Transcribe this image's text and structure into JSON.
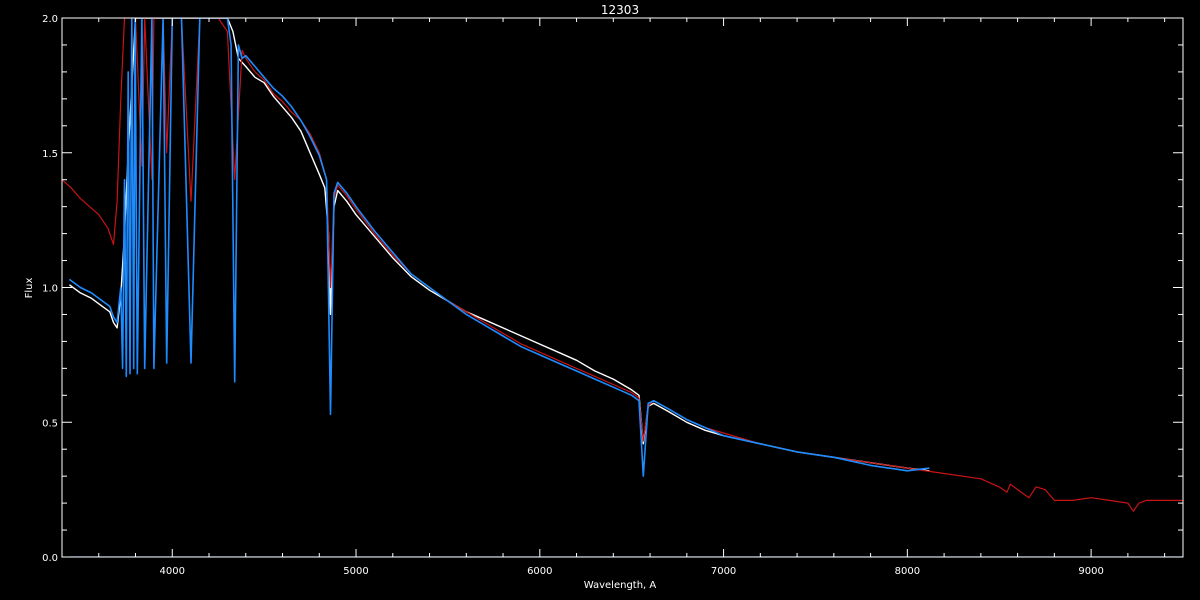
{
  "chart_data": {
    "type": "line",
    "title": "12303",
    "xlabel": "Wavelength, A",
    "ylabel": "Flux",
    "xlim": [
      3400,
      9500
    ],
    "ylim": [
      0.0,
      2.0
    ],
    "x_ticks": [
      4000,
      5000,
      6000,
      7000,
      8000,
      9000
    ],
    "y_ticks": [
      0.0,
      0.5,
      1.0,
      1.5,
      2.0
    ],
    "y_tick_labels": [
      "0.0",
      "0.5",
      "1.0",
      "1.5",
      "2.0"
    ],
    "grid": false,
    "background": "#000000",
    "series": [
      {
        "color": "#ffffff",
        "x": [
          3440,
          3500,
          3560,
          3620,
          3660,
          3680,
          3700,
          3720,
          3740,
          3760,
          3800,
          3850,
          3900,
          3950,
          4000,
          4050,
          4100,
          4150,
          4200,
          4250,
          4300,
          4330,
          4360,
          4400,
          4450,
          4500,
          4550,
          4600,
          4650,
          4700,
          4750,
          4800,
          4830,
          4850,
          4861,
          4880,
          4900,
          4950,
          5000,
          5100,
          5200,
          5300,
          5400,
          5500,
          5600,
          5700,
          5800,
          5900,
          6000,
          6100,
          6200,
          6300,
          6400,
          6500,
          6540,
          6563,
          6590,
          6620,
          6700,
          6800,
          6900,
          7000,
          7200,
          7400,
          7600,
          7800,
          8000,
          8120
        ],
        "y": [
          1.01,
          0.98,
          0.96,
          0.93,
          0.91,
          0.87,
          0.85,
          0.97,
          1.2,
          1.5,
          2.0,
          2.0,
          2.0,
          2.0,
          2.0,
          2.0,
          2.0,
          2.0,
          2.0,
          2.0,
          2.0,
          1.95,
          1.85,
          1.82,
          1.78,
          1.76,
          1.71,
          1.67,
          1.63,
          1.58,
          1.5,
          1.42,
          1.37,
          1.2,
          0.9,
          1.3,
          1.36,
          1.32,
          1.27,
          1.19,
          1.11,
          1.04,
          0.99,
          0.95,
          0.91,
          0.88,
          0.85,
          0.82,
          0.79,
          0.76,
          0.73,
          0.69,
          0.66,
          0.62,
          0.6,
          0.42,
          0.56,
          0.57,
          0.54,
          0.5,
          0.47,
          0.45,
          0.42,
          0.39,
          0.37,
          0.35,
          0.33,
          0.32
        ]
      },
      {
        "color": "#c81414",
        "x": [
          3400,
          3450,
          3500,
          3550,
          3600,
          3650,
          3680,
          3700,
          3720,
          3740,
          3760,
          3780,
          3800,
          3835,
          3850,
          3889,
          3900,
          3950,
          3970,
          4000,
          4050,
          4102,
          4150,
          4200,
          4250,
          4300,
          4340,
          4380,
          4400,
          4450,
          4500,
          4550,
          4600,
          4650,
          4700,
          4750,
          4800,
          4840,
          4861,
          4880,
          4900,
          4950,
          5000,
          5100,
          5200,
          5300,
          5400,
          5500,
          5600,
          5700,
          5800,
          5900,
          6000,
          6100,
          6200,
          6300,
          6400,
          6500,
          6540,
          6563,
          6590,
          6620,
          6700,
          6800,
          6900,
          7000,
          7200,
          7400,
          7600,
          7800,
          8000,
          8200,
          8400,
          8500,
          8542,
          8560,
          8600,
          8662,
          8700,
          8750,
          8800,
          8900,
          9000,
          9100,
          9200,
          9230,
          9260,
          9300,
          9400,
          9500
        ],
        "y": [
          1.4,
          1.37,
          1.33,
          1.3,
          1.27,
          1.22,
          1.16,
          1.32,
          1.7,
          2.0,
          2.0,
          2.0,
          2.0,
          1.45,
          2.0,
          1.4,
          2.0,
          2.0,
          1.5,
          2.0,
          2.0,
          1.32,
          2.0,
          2.0,
          2.0,
          1.95,
          1.4,
          1.88,
          1.85,
          1.8,
          1.77,
          1.72,
          1.69,
          1.65,
          1.62,
          1.57,
          1.5,
          1.4,
          1.0,
          1.33,
          1.38,
          1.34,
          1.29,
          1.2,
          1.12,
          1.05,
          1.0,
          0.95,
          0.91,
          0.87,
          0.83,
          0.79,
          0.76,
          0.73,
          0.7,
          0.67,
          0.64,
          0.61,
          0.59,
          0.43,
          0.56,
          0.58,
          0.55,
          0.51,
          0.48,
          0.46,
          0.42,
          0.39,
          0.37,
          0.35,
          0.33,
          0.31,
          0.29,
          0.26,
          0.24,
          0.27,
          0.25,
          0.22,
          0.26,
          0.25,
          0.21,
          0.21,
          0.22,
          0.21,
          0.2,
          0.17,
          0.2,
          0.21,
          0.21,
          0.21
        ]
      },
      {
        "color": "#1e8cff",
        "x": [
          3440,
          3500,
          3560,
          3620,
          3660,
          3680,
          3700,
          3720,
          3730,
          3740,
          3750,
          3760,
          3770,
          3780,
          3790,
          3798,
          3810,
          3835,
          3850,
          3889,
          3900,
          3950,
          3970,
          4000,
          4050,
          4102,
          4150,
          4200,
          4250,
          4300,
          4320,
          4340,
          4360,
          4380,
          4400,
          4450,
          4500,
          4550,
          4600,
          4650,
          4700,
          4750,
          4800,
          4840,
          4861,
          4880,
          4900,
          4950,
          5000,
          5100,
          5200,
          5300,
          5400,
          5500,
          5600,
          5700,
          5800,
          5900,
          6000,
          6100,
          6200,
          6300,
          6400,
          6500,
          6540,
          6563,
          6590,
          6620,
          6700,
          6800,
          6900,
          7000,
          7200,
          7400,
          7600,
          7800,
          8000,
          8120
        ],
        "y": [
          1.03,
          1.0,
          0.98,
          0.95,
          0.93,
          0.89,
          0.87,
          1.0,
          0.7,
          1.4,
          0.67,
          1.8,
          0.68,
          2.0,
          0.7,
          2.0,
          0.68,
          2.0,
          0.7,
          2.0,
          0.7,
          2.0,
          0.72,
          2.0,
          2.0,
          0.72,
          2.0,
          2.0,
          2.0,
          2.0,
          1.9,
          0.65,
          1.9,
          1.85,
          1.86,
          1.82,
          1.78,
          1.74,
          1.71,
          1.67,
          1.62,
          1.56,
          1.49,
          1.4,
          0.53,
          1.35,
          1.39,
          1.35,
          1.3,
          1.21,
          1.13,
          1.05,
          1.0,
          0.95,
          0.9,
          0.86,
          0.82,
          0.78,
          0.75,
          0.72,
          0.69,
          0.66,
          0.63,
          0.6,
          0.58,
          0.3,
          0.57,
          0.58,
          0.55,
          0.51,
          0.48,
          0.45,
          0.42,
          0.39,
          0.37,
          0.34,
          0.32,
          0.33
        ]
      }
    ],
    "baseline_series": {
      "color": "#1e8cff",
      "x": [
        3440,
        9500
      ],
      "y": [
        0.0,
        0.0
      ]
    }
  }
}
